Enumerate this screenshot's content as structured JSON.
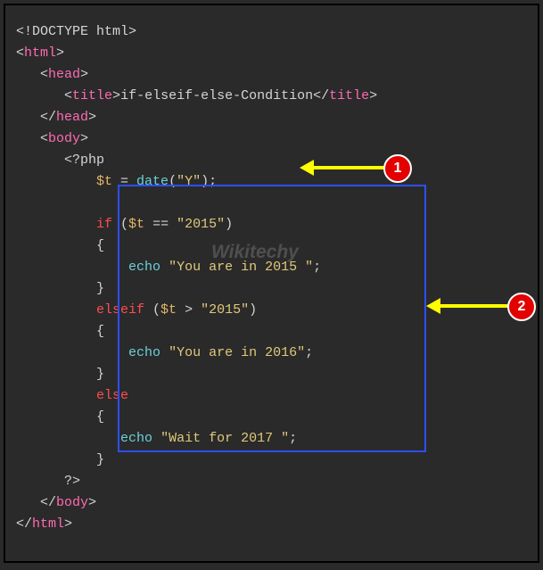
{
  "code": {
    "l1a": "<!DOCTYPE html",
    "l1b": ">",
    "l2a": "<",
    "l2b": "html",
    "l2c": ">",
    "l3a": "<",
    "l3b": "head",
    "l3c": ">",
    "l4a": "<",
    "l4b": "title",
    "l4c": ">",
    "l4d": "if-elseif-else-Condition",
    "l4e": "</",
    "l4f": "title",
    "l4g": ">",
    "l5a": "</",
    "l5b": "head",
    "l5c": ">",
    "l6a": "<",
    "l6b": "body",
    "l6c": ">",
    "l7a": "<?",
    "l7b": "php",
    "l8a": "$t",
    "l8b": " = ",
    "l8c": "date",
    "l8d": "(",
    "l8e": "\"Y\"",
    "l8f": ");",
    "l10a": "if",
    "l10b": " (",
    "l10c": "$t",
    "l10d": " == ",
    "l10e": "\"2015\"",
    "l10f": ")",
    "l11": "{",
    "l12a": "echo",
    "l12b": " ",
    "l12c": "\"You are in 2015 \"",
    "l12d": ";",
    "l13": "}",
    "l14a": "elseif",
    "l14b": " (",
    "l14c": "$t",
    "l14d": " > ",
    "l14e": "\"2015\"",
    "l14f": ")",
    "l15": "{",
    "l16a": "echo",
    "l16b": " ",
    "l16c": "\"You are in 2016\"",
    "l16d": ";",
    "l17": "}",
    "l18a": "else",
    "l19": "{",
    "l20a": "echo",
    "l20b": " ",
    "l20c": "\"Wait for 2017 \"",
    "l20d": ";",
    "l21": "}",
    "l22": "?>",
    "l23a": "</",
    "l23b": "body",
    "l23c": ">",
    "l24a": "</",
    "l24b": "html",
    "l24c": ">"
  },
  "badges": {
    "one": "1",
    "two": "2"
  },
  "watermark": "Wikitechy"
}
